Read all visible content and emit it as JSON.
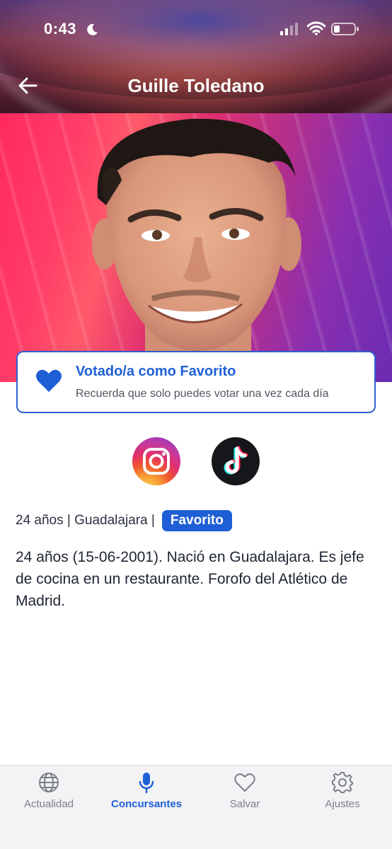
{
  "status_bar": {
    "time": "0:43"
  },
  "nav": {
    "title": "Guille Toledano"
  },
  "vote_card": {
    "title": "Votado/a como Favorito",
    "subtitle": "Recuerda que solo puedes votar una vez cada día"
  },
  "profile": {
    "age_city": "24 años | Guadalajara |",
    "badge": "Favorito",
    "bio": "24 años (15-06-2001). Nació en Guadalajara. Es jefe de cocina en un restaurante. Forofo del Atlético de Madrid."
  },
  "social": [
    "instagram-icon",
    "tiktok-icon"
  ],
  "tabs": [
    {
      "label": "Actualidad",
      "icon": "globe-icon",
      "active": false
    },
    {
      "label": "Concursantes",
      "icon": "microphone-icon",
      "active": true
    },
    {
      "label": "Salvar",
      "icon": "heart-outline-icon",
      "active": false
    },
    {
      "label": "Ajustes",
      "icon": "gear-icon",
      "active": false
    }
  ],
  "colors": {
    "accent": "#1f5fd6",
    "tab_inactive": "#7b8088"
  }
}
